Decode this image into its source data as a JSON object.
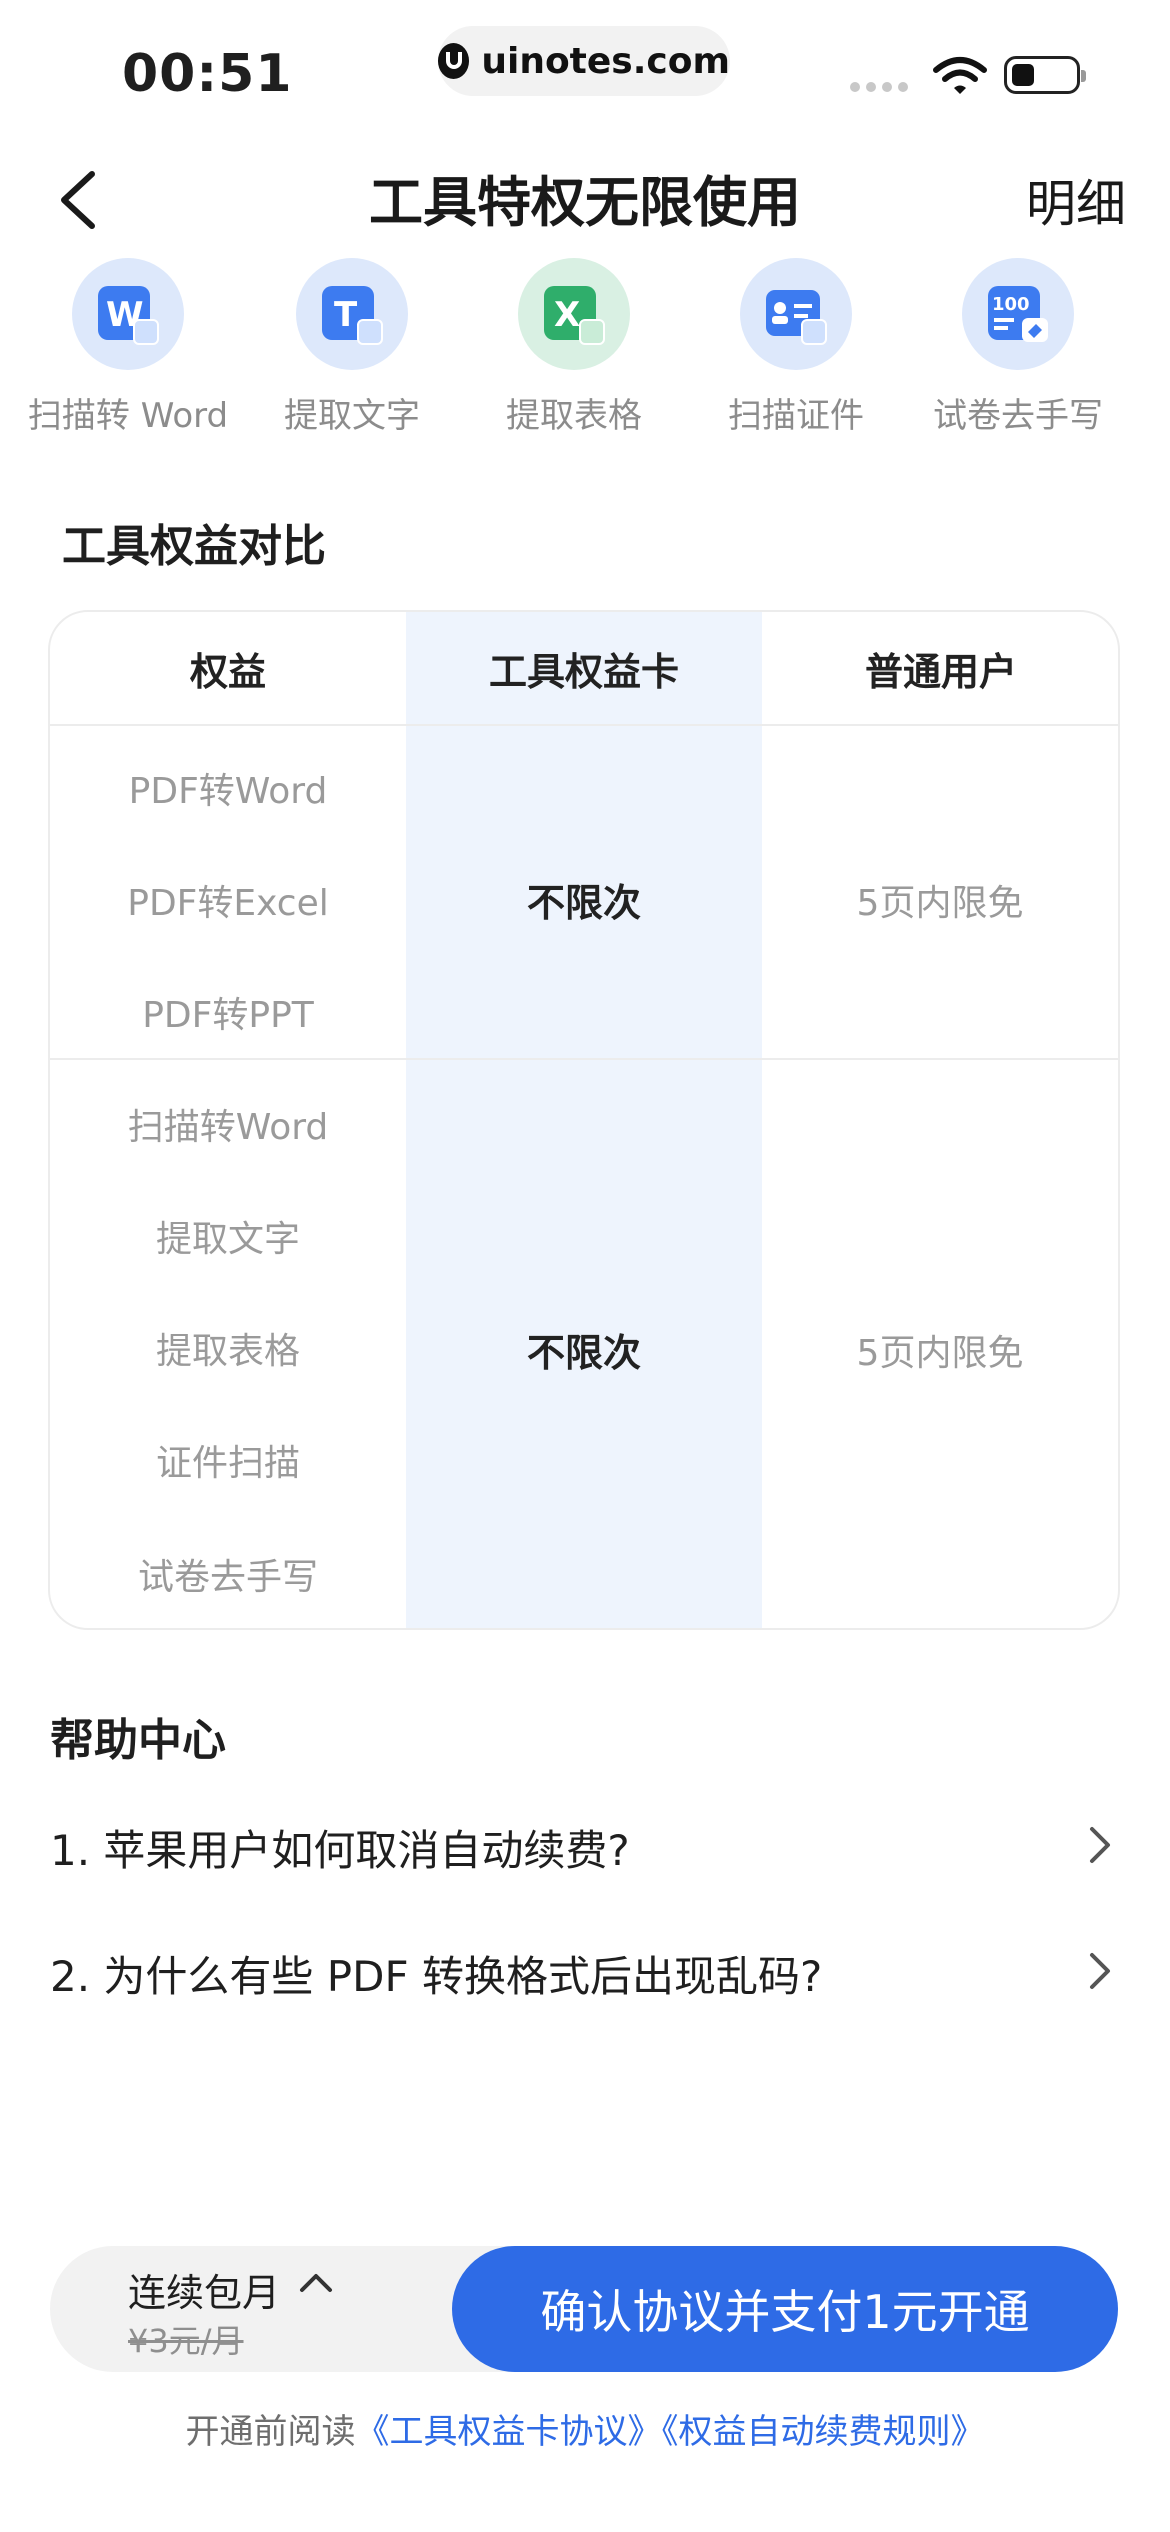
{
  "status_bar": {
    "time": "00:51",
    "url": "uinotes.com"
  },
  "header": {
    "title": "工具特权无限使用",
    "detail": "明细"
  },
  "tools": [
    {
      "label": "扫描转 Word",
      "icon": "scan-to-word-icon",
      "glyph": "W",
      "color": "#3d7bf0"
    },
    {
      "label": "提取文字",
      "icon": "extract-text-icon",
      "glyph": "T",
      "color": "#3d7bf0"
    },
    {
      "label": "提取表格",
      "icon": "extract-table-icon",
      "glyph": "X",
      "color": "#2fae6b"
    },
    {
      "label": "扫描证件",
      "icon": "scan-id-icon",
      "glyph": "",
      "color": "#3d7bf0"
    },
    {
      "label": "试卷去手写",
      "icon": "remove-handwriting-icon",
      "glyph": "100",
      "color": "#3d7bf0"
    }
  ],
  "compare": {
    "title": "工具权益对比",
    "headers": [
      "权益",
      "工具权益卡",
      "普通用户"
    ],
    "group1": {
      "features": [
        "PDF转Word",
        "PDF转Excel",
        "PDF转PPT"
      ],
      "card": "不限次",
      "normal": "5页内限免"
    },
    "group2": {
      "features": [
        "扫描转Word",
        "提取文字",
        "提取表格",
        "证件扫描",
        "试卷去手写"
      ],
      "card": "不限次",
      "normal": "5页内限免"
    }
  },
  "help": {
    "title": "帮助中心",
    "items": [
      "1. 苹果用户如何取消自动续费?",
      "2. 为什么有些 PDF 转换格式后出现乱码?"
    ]
  },
  "plan": {
    "name": "连续包月",
    "price": "¥3元/月"
  },
  "pay_button": "确认协议并支付1元开通",
  "agreement": {
    "prefix": "开通前阅读",
    "link1": "《工具权益卡协议》",
    "link2": "《权益自动续费规则》"
  },
  "colors": {
    "accent": "#2e6be6",
    "highlight_column": "#eef4fd"
  }
}
